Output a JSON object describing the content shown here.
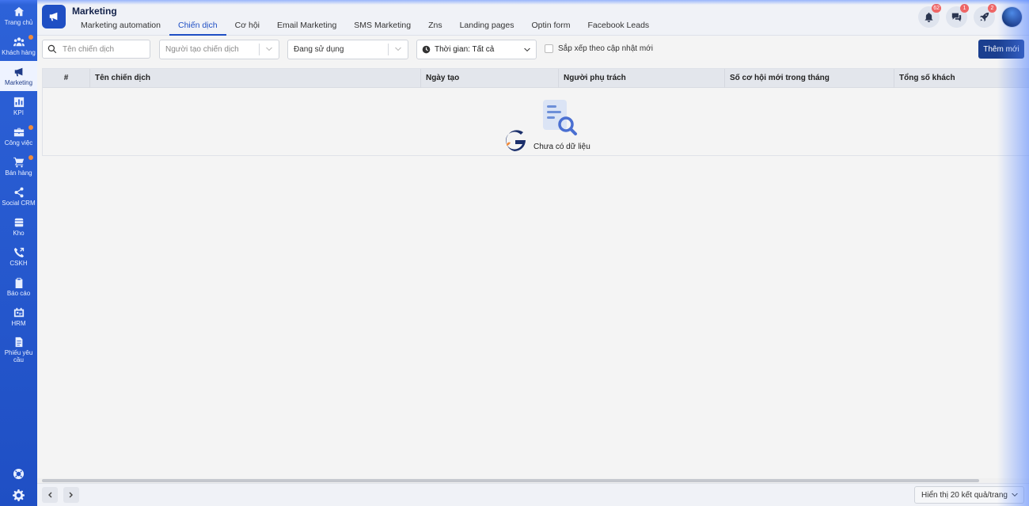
{
  "sidebar": {
    "items": [
      {
        "label": "Trang chủ",
        "icon": "home-icon",
        "dot": false,
        "active": false
      },
      {
        "label": "Khách hàng",
        "icon": "users-icon",
        "dot": true,
        "active": false
      },
      {
        "label": "Marketing",
        "icon": "megaphone-icon",
        "dot": false,
        "active": true
      },
      {
        "label": "KPI",
        "icon": "bar-chart-icon",
        "dot": false,
        "active": false
      },
      {
        "label": "Công việc",
        "icon": "briefcase-icon",
        "dot": true,
        "active": false
      },
      {
        "label": "Bán hàng",
        "icon": "cart-icon",
        "dot": true,
        "active": false
      },
      {
        "label": "Social CRM",
        "icon": "share-icon",
        "dot": false,
        "active": false
      },
      {
        "label": "Kho",
        "icon": "warehouse-icon",
        "dot": false,
        "active": false
      },
      {
        "label": "CSKH",
        "icon": "phone-icon",
        "dot": false,
        "active": false
      },
      {
        "label": "Báo cáo",
        "icon": "clipboard-icon",
        "dot": false,
        "active": false
      },
      {
        "label": "HRM",
        "icon": "id-card-icon",
        "dot": false,
        "active": false
      },
      {
        "label": "Phiếu yêu cầu",
        "icon": "document-icon",
        "dot": false,
        "active": false
      }
    ]
  },
  "header": {
    "title": "Marketing",
    "tabs": [
      {
        "label": "Marketing automation",
        "active": false
      },
      {
        "label": "Chiến dịch",
        "active": true
      },
      {
        "label": "Cơ hội",
        "active": false
      },
      {
        "label": "Email Marketing",
        "active": false
      },
      {
        "label": "SMS Marketing",
        "active": false
      },
      {
        "label": "Zns",
        "active": false
      },
      {
        "label": "Landing pages",
        "active": false
      },
      {
        "label": "Optin form",
        "active": false
      },
      {
        "label": "Facebook Leads",
        "active": false
      }
    ],
    "notifications_badge": "62",
    "messages_badge": "1",
    "rocket_badge": "2"
  },
  "toolbar": {
    "search_placeholder": "Tên chiến dịch",
    "creator_placeholder": "Người tạo chiến dịch",
    "status_value": "Đang sử dụng",
    "time_value": "Thời gian: Tất cả",
    "sort_label": "Sắp xếp theo cập nhật mới",
    "add_label": "Thêm mới"
  },
  "table": {
    "columns": [
      "#",
      "Tên chiến dịch",
      "Ngày tạo",
      "Người phụ trách",
      "Số cơ hội mới trong tháng",
      "Tổng số khách"
    ],
    "empty_text": "Chưa có dữ liệu"
  },
  "footer": {
    "page_size_label": "Hiển thị 20 kết quả/trang"
  },
  "colors": {
    "sidebar": "#2d62d8",
    "accent": "#1f4fc4",
    "primary_button": "#1b3f8f",
    "dot": "#f08a3a"
  }
}
